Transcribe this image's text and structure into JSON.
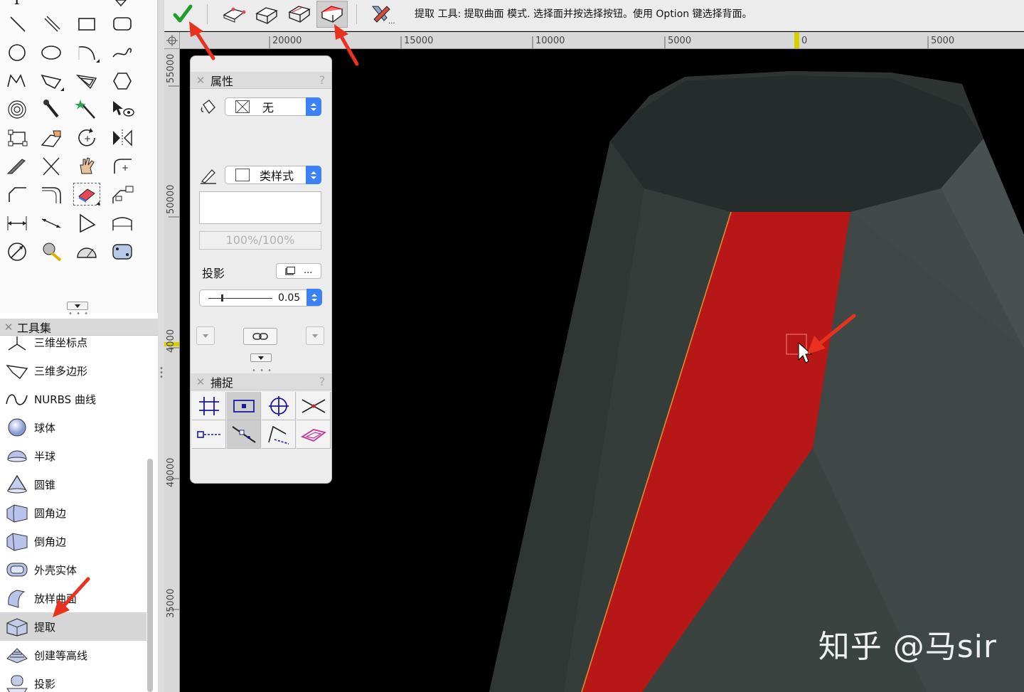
{
  "mode_bar": {
    "hint": "提取 工具: 提取曲面 模式. 选择面并按选择按钮。使用 Option 键选择背面。",
    "icons": [
      "checkmark-icon",
      "extract-curve-mode-icon",
      "extract-surface-mode-icon",
      "extract-faces-mode-icon",
      "extract-face-mode-icon",
      "tool-preferences-icon"
    ]
  },
  "ruler": {
    "h_labels": [
      "20000",
      "15000",
      "10000",
      "5000",
      "0",
      "5000"
    ],
    "v_labels": [
      "55000",
      "50000",
      "4000",
      "40000",
      "35000"
    ]
  },
  "tool_palette": {
    "tools": [
      "line",
      "double-line",
      "rectangle",
      "rounded-rectangle",
      "circle",
      "oval",
      "arc",
      "freehand",
      "polyline",
      "polygon",
      "double-polygon",
      "regular-polygon",
      "spiral",
      "eyedropper",
      "magic-wand",
      "visibility",
      "reshape",
      "attribute-mapping",
      "rotate",
      "mirror",
      "knife",
      "trim",
      "pan",
      "fillet",
      "chamfer",
      "fillet-arc",
      "eraser-clip",
      "offset",
      "dimension",
      "angular-dimension",
      "dimension-diagonal",
      "arc-length",
      "protractor",
      "flyover",
      "protractor-tool",
      "cylinder-object"
    ]
  },
  "toolsets": {
    "title": "工具集",
    "items": [
      {
        "label": "三维坐标点",
        "icon": "3d-locus-icon"
      },
      {
        "label": "三维多边形",
        "icon": "3d-polygon-icon"
      },
      {
        "label": "NURBS 曲线",
        "icon": "nurbs-curve-icon"
      },
      {
        "label": "球体",
        "icon": "sphere-icon"
      },
      {
        "label": "半球",
        "icon": "hemisphere-icon"
      },
      {
        "label": "圆锥",
        "icon": "cone-icon"
      },
      {
        "label": "圆角边",
        "icon": "fillet-edge-icon"
      },
      {
        "label": "倒角边",
        "icon": "chamfer-edge-icon"
      },
      {
        "label": "外壳实体",
        "icon": "shell-solid-icon"
      },
      {
        "label": "放样曲面",
        "icon": "loft-surface-icon"
      },
      {
        "label": "提取",
        "icon": "extract-icon"
      },
      {
        "label": "创建等高线",
        "icon": "create-contours-icon"
      },
      {
        "label": "投影",
        "icon": "project-icon"
      }
    ],
    "active_index": 10
  },
  "attributes": {
    "title": "属性",
    "help": "?",
    "fill_value": "无",
    "pen_value": "类样式",
    "opacity": "100%/100%",
    "shadow_label": "投影",
    "shadow_more": "...",
    "line_weight": "0.05"
  },
  "snapping": {
    "title": "捕捉",
    "help": "?",
    "buttons": [
      "snap-to-grid",
      "snap-to-object",
      "snap-to-angle",
      "smart-points",
      "smart-edge",
      "snap-to-distance",
      "tangent",
      "working-plane"
    ]
  },
  "watermark": "知乎 @马sir",
  "colors": {
    "accent_blue": "#3b82f6",
    "extracted_face": "#b81717",
    "model_gray": "#3b4341",
    "annotation_arrow": "#e8321f",
    "checkmark": "#1f9d2b"
  }
}
